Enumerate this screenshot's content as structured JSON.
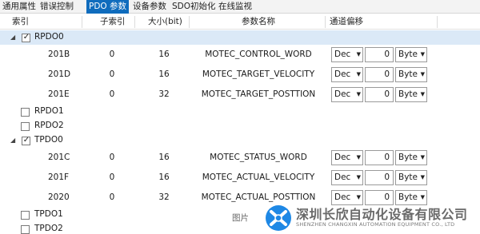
{
  "tabs": [
    "通用属性",
    "错误控制",
    "PDO 参数",
    "设备参数",
    "SDO初始化",
    "在线监视"
  ],
  "active_tab": "PDO 参数",
  "columns": [
    "索引",
    "子索引",
    "大小(bit)",
    "参数名称",
    "通道偏移"
  ],
  "rows": [
    {
      "kind": "group",
      "label": "RPDO0",
      "expanded": true,
      "checked": true,
      "selected": true
    },
    {
      "kind": "entry",
      "index": "201B",
      "subindex": "0",
      "size": "16",
      "name": "MOTEC_CONTROL_WORD",
      "format": "Dec",
      "offset": "0",
      "unit": "Byte"
    },
    {
      "kind": "entry",
      "index": "201D",
      "subindex": "0",
      "size": "16",
      "name": "MOTEC_TARGET_VELOCITY",
      "format": "Dec",
      "offset": "0",
      "unit": "Byte"
    },
    {
      "kind": "entry",
      "index": "201E",
      "subindex": "0",
      "size": "32",
      "name": "MOTEC_TARGET_POSTTION",
      "format": "Dec",
      "offset": "0",
      "unit": "Byte"
    },
    {
      "kind": "group",
      "label": "RPDO1",
      "expanded": false,
      "checked": false,
      "selected": false
    },
    {
      "kind": "group",
      "label": "RPDO2",
      "expanded": false,
      "checked": false,
      "selected": false
    },
    {
      "kind": "group",
      "label": "TPDO0",
      "expanded": true,
      "checked": true,
      "selected": false
    },
    {
      "kind": "entry",
      "index": "201C",
      "subindex": "0",
      "size": "16",
      "name": "MOTEC_STATUS_WORD",
      "format": "Dec",
      "offset": "0",
      "unit": "Byte"
    },
    {
      "kind": "entry",
      "index": "201F",
      "subindex": "0",
      "size": "16",
      "name": "MOTEC_ACTUAL_VELOCITY",
      "format": "Dec",
      "offset": "0",
      "unit": "Byte"
    },
    {
      "kind": "entry",
      "index": "2020",
      "subindex": "0",
      "size": "32",
      "name": "MOTEC_ACTUAL_POSTTION",
      "format": "Dec",
      "offset": "0",
      "unit": "Byte"
    },
    {
      "kind": "group",
      "label": "TPDO1",
      "expanded": false,
      "checked": false,
      "selected": false
    },
    {
      "kind": "group",
      "label": "TPDO2",
      "expanded": false,
      "checked": false,
      "selected": false
    }
  ],
  "watermark": {
    "caption": "图片",
    "company_cn": "深圳长欣自动化设备有限公司",
    "company_en": "SHENZHEN CHANGXIN AUTOMATION EQUIPMENT CO., LTD"
  },
  "colors": {
    "accent": "#0f6cbd",
    "selected_row": "#dbe9f7",
    "logo_blue": "#1e88e5"
  }
}
